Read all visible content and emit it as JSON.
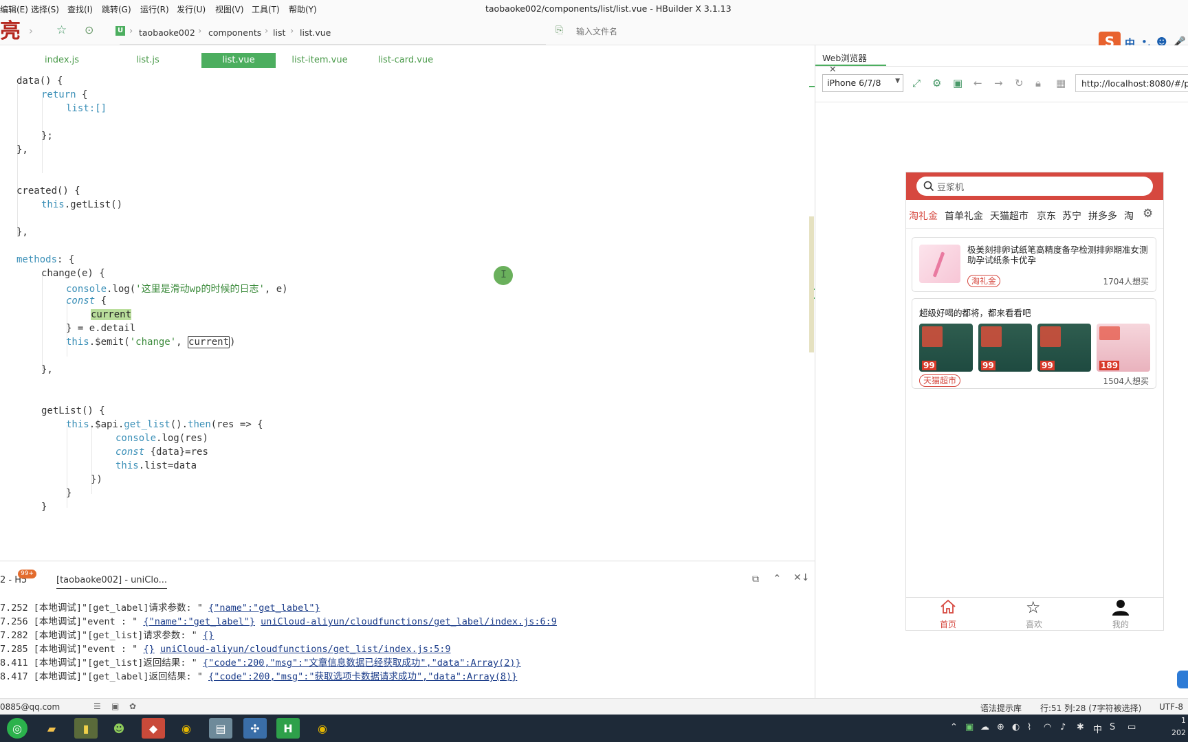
{
  "menu": [
    "编辑(E)",
    "选择(S)",
    "查找(I)",
    "跳转(G)",
    "运行(R)",
    "发行(U)",
    "视图(V)",
    "工具(T)",
    "帮助(Y)"
  ],
  "window_title": "taobaoke002/components/list/list.vue - HBuilder X 3.1.13",
  "toolbar": {
    "logo_char": "亮",
    "breadcrumb": [
      "taobaoke002",
      "components",
      "list",
      "list.vue"
    ],
    "file_search_placeholder": "输入文件名",
    "ime": [
      "中",
      "•,",
      "☻",
      "🎤"
    ]
  },
  "editor_tabs": [
    "index.js",
    "list.js",
    "list.vue",
    "list-item.vue",
    "list-card.vue"
  ],
  "code": {
    "l1": "data() {",
    "l2a": "return",
    "l2b": " {",
    "l3": "list:[]",
    "l5": "};",
    "l6": "},",
    "l9": "created() {",
    "l10a": "this",
    "l10b": ".getList()",
    "l12": "},",
    "l14a": "methods",
    "l14b": ": {",
    "l15": "change(e) {",
    "l16a": "console",
    "l16b": ".log(",
    "l16c": "'这里是滑动wp的时候的日志'",
    "l16d": ", e)",
    "l17a": "const",
    "l17b": " {",
    "l18": "current",
    "l19": "} = e.detail",
    "l20a": "this",
    "l20b": ".$emit(",
    "l20c": "'change'",
    "l20d": ", ",
    "l20e": "current",
    "l20f": ")",
    "l22": "},",
    "l25": "getList() {",
    "l26a": "this",
    "l26b": ".$api.",
    "l26c": "get_list",
    "l26d": "().",
    "l26e": "then",
    "l26f": "(res => {",
    "l27a": "console",
    "l27b": ".log(res)",
    "l28a": "const",
    "l28b": " {data}=res",
    "l29a": "this",
    "l29b": ".list=data",
    "l30": "})",
    "l31": "}",
    "l32": "}"
  },
  "console": {
    "tab_left": "2 - H5",
    "tab_badge": "99+",
    "tab_active": "[taobaoke002] - uniClo...",
    "lines": [
      {
        "time": "7.252",
        "text": " [本地调试]\"[get_label]请求参数: \" ",
        "link": "{\"name\":\"get_label\"}",
        "link2": ""
      },
      {
        "time": "7.256",
        "text": " [本地调试]\"event : \" ",
        "link": "{\"name\":\"get_label\"}",
        "link2": "uniCloud-aliyun/cloudfunctions/get_label/index.js:6:9"
      },
      {
        "time": "7.282",
        "text": " [本地调试]\"[get_list]请求参数: \" ",
        "link": "{}",
        "link2": ""
      },
      {
        "time": "7.285",
        "text": " [本地调试]\"event : \" ",
        "link": "{}",
        "link2": "uniCloud-aliyun/cloudfunctions/get_list/index.js:5:9"
      },
      {
        "time": "8.411",
        "text": " [本地调试]\"[get_list]返回结果: \" ",
        "link": "{\"code\":200,\"msg\":\"文章信息数据已经获取成功\",\"data\":Array(2)}",
        "link2": ""
      },
      {
        "time": "8.417",
        "text": " [本地调试]\"[get_label]返回结果: \" ",
        "link": "{\"code\":200,\"msg\":\"获取选项卡数据请求成功\",\"data\":Array(8)}",
        "link2": ""
      }
    ]
  },
  "browser": {
    "tab_title": "Web浏览器",
    "device": "iPhone 6/7/8",
    "url": "http://localhost:8080/#/pag"
  },
  "phone": {
    "search_placeholder": "豆浆机",
    "categories": [
      "淘礼金",
      "首单礼金",
      "天猫超市",
      "京东",
      "苏宁",
      "拼多多",
      "淘"
    ],
    "card1": {
      "title": "极美刻排卵试纸笔高精度备孕检测排卵期准女测助孕试纸条卡优孕",
      "badge": "淘礼金",
      "want": "1704人想买"
    },
    "card2": {
      "title": "超级好喝的都将，都来看看吧",
      "badge": "天猫超市",
      "want": "1504人想买",
      "prices": [
        "99",
        "99",
        "99",
        "189"
      ]
    },
    "nav": [
      "首页",
      "喜欢",
      "我的"
    ]
  },
  "status": {
    "email": "0885@qq.com",
    "hint": "语法提示库",
    "position": "行:51   列:28 (7字符被选择)",
    "encoding": "UTF-8"
  },
  "taskbar": {
    "tray_ime": "中",
    "clock_top": "1",
    "clock_bottom": "202"
  },
  "colors": {
    "accent": "#4cae5f",
    "brand_red": "#d6483f",
    "link": "#1c3d8a"
  }
}
